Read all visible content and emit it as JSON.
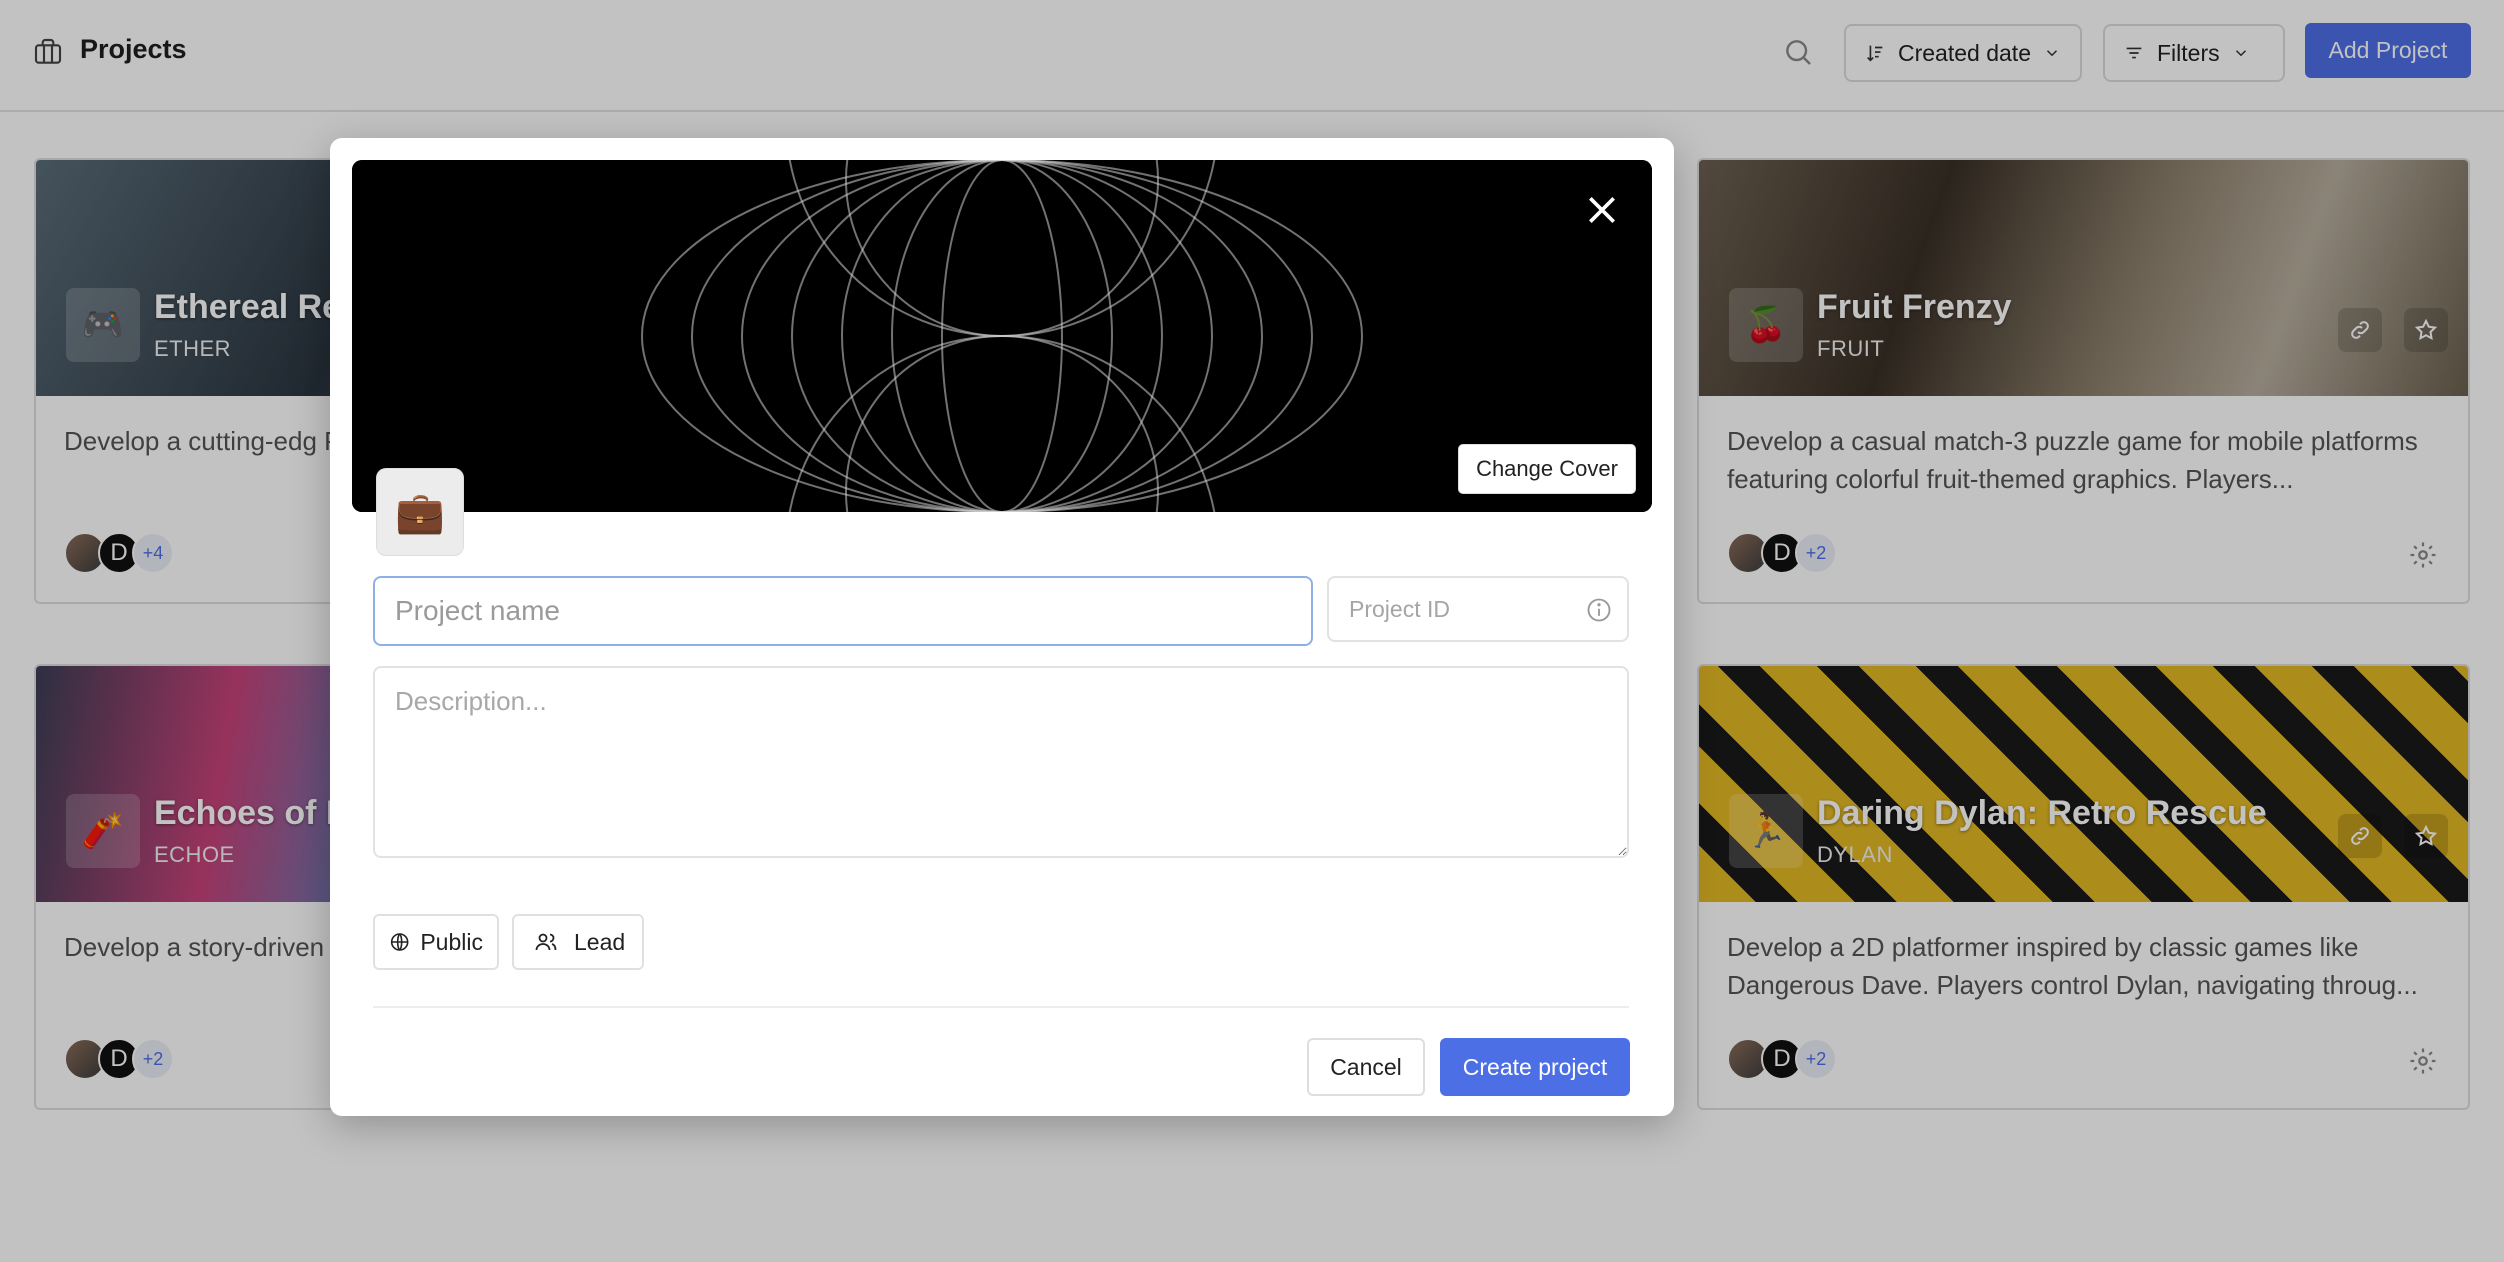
{
  "header": {
    "title": "Projects",
    "sort_label": "Created date",
    "filters_label": "Filters",
    "add_label": "Add Project"
  },
  "cards": [
    {
      "name": "Ethereal Re",
      "code": "ETHER",
      "emoji": "🎮",
      "description": "Develop a cutting-edg Playing Game (MMORP",
      "avatar_letter": "D",
      "extra_count": "+4"
    },
    {
      "name": "Fruit Frenzy",
      "code": "FRUIT",
      "emoji": "🍒",
      "description": "Develop a casual match-3 puzzle game for mobile platforms featuring colorful fruit-themed graphics. Players...",
      "avatar_letter": "D",
      "extra_count": "+2"
    },
    {
      "name": "Echoes of E",
      "code": "ECHOE",
      "emoji": "🧨",
      "description": "Develop a story-driven represents a significan",
      "avatar_letter": "D",
      "extra_count": "+2"
    },
    {
      "name": "Daring Dylan: Retro Rescue",
      "code": "DYLAN",
      "emoji": "🏃",
      "description": "Develop a 2D platformer inspired by classic games like Dangerous Dave. Players control Dylan, navigating throug...",
      "avatar_letter": "D",
      "extra_count": "+2"
    }
  ],
  "modal": {
    "emoji": "💼",
    "change_cover_label": "Change Cover",
    "name_placeholder": "Project name",
    "name_value": "",
    "id_placeholder": "Project ID",
    "id_value": "",
    "description_placeholder": "Description...",
    "public_label": "Public",
    "lead_label": "Lead",
    "cancel_label": "Cancel",
    "create_label": "Create project"
  },
  "colors": {
    "primary": "#4d6fe6",
    "overlay": "rgba(0,0,0,0.24)"
  }
}
